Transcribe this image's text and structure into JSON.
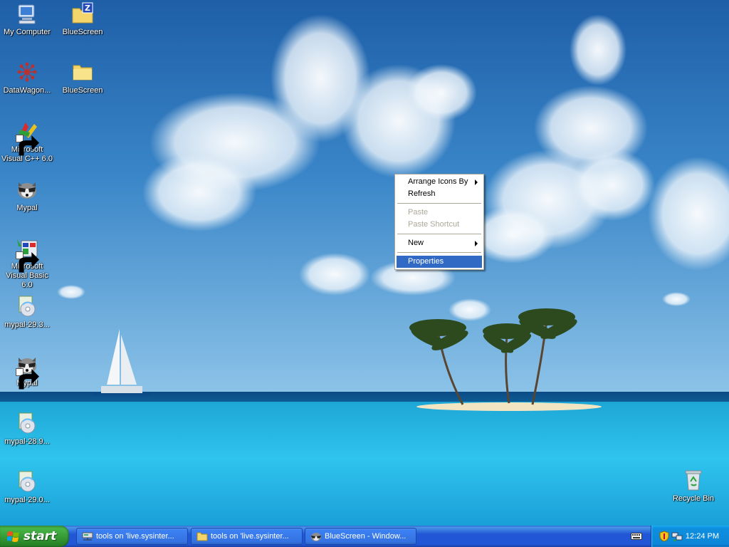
{
  "desktop": {
    "icons": [
      {
        "label": "My Computer",
        "icon": "my-computer-icon"
      },
      {
        "label": "BlueScreen",
        "icon": "zip-folder-icon"
      },
      {
        "label": "DataWagon...",
        "icon": "datawagon-icon"
      },
      {
        "label": "BlueScreen",
        "icon": "folder-icon"
      },
      {
        "label": "Microsoft Visual C++ 6.0",
        "icon": "visual-cpp-icon"
      },
      {
        "label": "Mypal",
        "icon": "mypal-icon"
      },
      {
        "label": "Microsoft Visual Basic 6.0",
        "icon": "visual-basic-icon"
      },
      {
        "label": "mypal-29.3...",
        "icon": "installer-icon"
      },
      {
        "label": "Mypal",
        "icon": "mypal-icon"
      },
      {
        "label": "mypal-28.9...",
        "icon": "installer-icon"
      },
      {
        "label": "mypal-29.0...",
        "icon": "installer-icon"
      },
      {
        "label": "Recycle Bin",
        "icon": "recycle-bin-icon"
      }
    ]
  },
  "context_menu": {
    "items": [
      {
        "label": "Arrange Icons By",
        "submenu": true,
        "enabled": true
      },
      {
        "label": "Refresh",
        "enabled": true
      },
      {
        "label": "Paste",
        "enabled": false
      },
      {
        "label": "Paste Shortcut",
        "enabled": false
      },
      {
        "label": "New",
        "submenu": true,
        "enabled": true
      },
      {
        "label": "Properties",
        "enabled": true,
        "selected": true
      }
    ]
  },
  "taskbar": {
    "start_label": "start",
    "tasks": [
      {
        "label": "tools on 'live.sysinter...",
        "icon": "network-drive-icon"
      },
      {
        "label": "tools on 'live.sysinter...",
        "icon": "folder-icon"
      },
      {
        "label": "BlueScreen - Window...",
        "icon": "mypal-icon"
      }
    ],
    "clock": "12:24 PM"
  },
  "colors": {
    "selection": "#316ac5",
    "taskbar": "#2157d7",
    "start_green": "#3c9a3c",
    "tray": "#0c86d8"
  }
}
